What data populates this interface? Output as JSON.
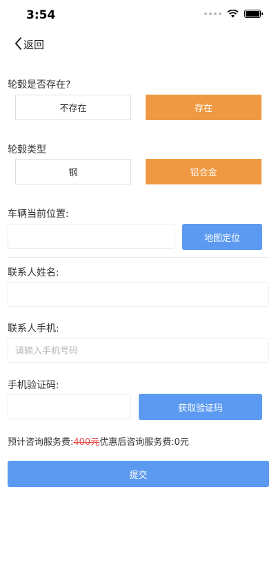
{
  "status_bar": {
    "time": "3:54"
  },
  "nav": {
    "back_label": "返回"
  },
  "hub_exists": {
    "label": "轮毂是否存在?",
    "options": [
      {
        "label": "不存在",
        "selected": false
      },
      {
        "label": "存在",
        "selected": true
      }
    ]
  },
  "hub_type": {
    "label": "轮毂类型",
    "options": [
      {
        "label": "钢",
        "selected": false
      },
      {
        "label": "铝合金",
        "selected": true
      }
    ]
  },
  "location": {
    "label": "车辆当前位置:",
    "value": "",
    "button_label": "地图定位"
  },
  "contact_name": {
    "label": "联系人姓名:",
    "value": ""
  },
  "contact_phone": {
    "label": "联系人手机:",
    "placeholder": "请输入手机号码"
  },
  "verify_code": {
    "label": "手机验证码:",
    "value": "",
    "button_label": "获取验证码"
  },
  "fee": {
    "prefix": "预计咨询服务费:",
    "original": "400元",
    "discount_label": "优惠后咨询服务费:",
    "discount_value": "0元"
  },
  "submit_label": "提交",
  "colors": {
    "accent_orange": "#ef9a43",
    "primary_blue": "#5b9af0",
    "strike_red": "#e34b4b"
  }
}
